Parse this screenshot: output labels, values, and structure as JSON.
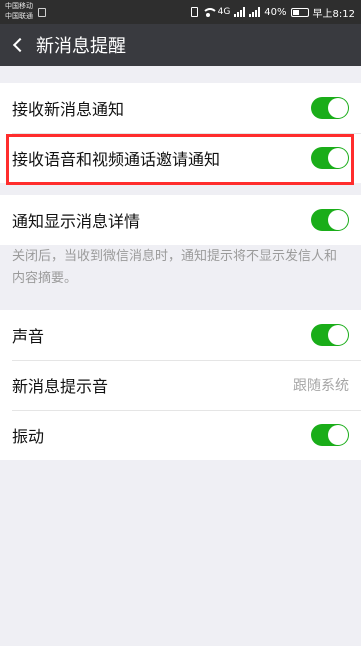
{
  "status_bar": {
    "carrier_1": "中国移动",
    "carrier_2": "中国联通",
    "network_type": "4G",
    "battery": "40%",
    "time": "早上8:12",
    "icons": [
      "vibrate-icon",
      "wifi-icon",
      "signal-icon",
      "battery-icon"
    ]
  },
  "app_bar": {
    "back_icon": "chevron-left-icon",
    "title": "新消息提醒"
  },
  "group_1": {
    "items": [
      {
        "label": "接收新消息通知",
        "toggle": "on"
      },
      {
        "label": "接收语音和视频通话邀请通知",
        "toggle": "on"
      },
      {
        "label": "通知显示消息详情",
        "toggle": "on"
      }
    ],
    "hint": "关闭后，当收到微信消息时，通知提示将不显示发信人和内容摘要。"
  },
  "group_2": {
    "items": [
      {
        "label": "声音",
        "toggle": "on"
      },
      {
        "label": "新消息提示音",
        "value": "跟随系统"
      },
      {
        "label": "振动",
        "toggle": "on"
      }
    ]
  },
  "colors": {
    "accent_green": "#1aad19",
    "app_bar": "#393a3f",
    "highlight": "#ff2d2d",
    "background": "#efeff4"
  }
}
